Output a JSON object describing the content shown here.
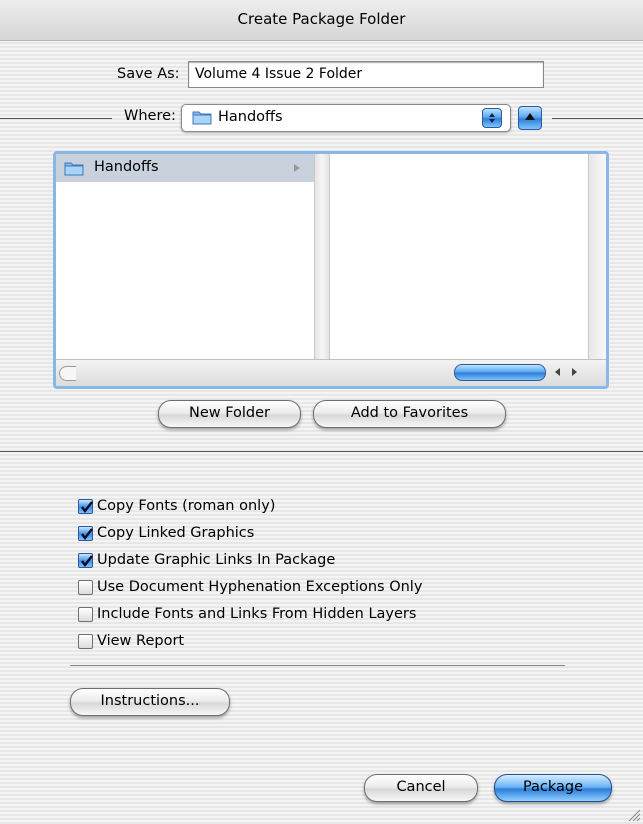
{
  "window": {
    "title": "Create Package Folder"
  },
  "save_as": {
    "label": "Save As:",
    "value": "Volume 4 Issue 2 Folder"
  },
  "where": {
    "label": "Where:",
    "selected": "Handoffs"
  },
  "browser": {
    "column1": [
      {
        "name": "Handoffs",
        "selected": true,
        "has_children": true
      }
    ],
    "column2": []
  },
  "buttons": {
    "new_folder": "New Folder",
    "add_favorites": "Add to Favorites",
    "instructions": "Instructions...",
    "cancel": "Cancel",
    "package": "Package"
  },
  "options": [
    {
      "label": "Copy Fonts (roman only)",
      "checked": true
    },
    {
      "label": "Copy Linked Graphics",
      "checked": true
    },
    {
      "label": "Update Graphic Links In Package",
      "checked": true
    },
    {
      "label": "Use Document Hyphenation Exceptions Only",
      "checked": false
    },
    {
      "label": "Include Fonts and Links From Hidden Layers",
      "checked": false
    },
    {
      "label": "View Report",
      "checked": false
    }
  ],
  "colors": {
    "accent": "#3a8ee6",
    "selection": "#c9d2dc",
    "focus_ring": "#89b8e8"
  }
}
